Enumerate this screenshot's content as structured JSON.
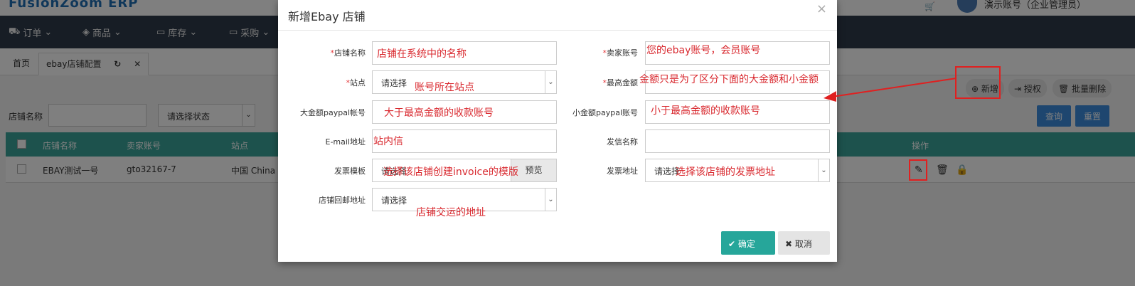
{
  "app": {
    "logo": "FusionZoom ERP",
    "cart_icon": "cart-icon",
    "user_name": "演示账号（企业管理员）",
    "nav": [
      {
        "icon": "cart-icon",
        "label": "订单"
      },
      {
        "icon": "cube-icon",
        "label": "商品"
      },
      {
        "icon": "inbox-icon",
        "label": "库存"
      },
      {
        "icon": "card-icon",
        "label": "采购"
      }
    ],
    "tabs": {
      "home": "首页",
      "active": "ebay店铺配置"
    },
    "filter": {
      "label": "店铺名称",
      "status_placeholder": "请选择状态"
    },
    "buttons": {
      "add": "新增",
      "auth": "授权",
      "batch_delete": "批量删除",
      "query": "查询",
      "reset": "重置"
    },
    "table": {
      "headers": [
        "店铺名称",
        "卖家账号",
        "站点",
        "操作"
      ],
      "rows": [
        {
          "shop_name": "EBAY测试一号",
          "seller": "gto32167-7",
          "site": "中国 China"
        }
      ]
    }
  },
  "modal": {
    "title": "新增Ebay 店铺",
    "fields": {
      "shop_name": {
        "label": "店铺名称",
        "required": "*",
        "note": "店铺在系统中的名称"
      },
      "seller_account": {
        "label": "卖家账号",
        "required": "*",
        "note": "您的ebay账号，会员账号"
      },
      "site": {
        "label": "站点",
        "required": "*",
        "placeholder": "请选择",
        "note": "账号所在站点"
      },
      "max_amount": {
        "label": "最高金额",
        "required": "*",
        "note": "金额只是为了区分下面的大金额和小金额"
      },
      "big_paypal": {
        "label": "大金额paypal帐号",
        "note": "大于最高金额的收款账号"
      },
      "small_paypal": {
        "label": "小金额paypal账号",
        "note": "小于最高金额的收款账号"
      },
      "email": {
        "label": "E-mail地址",
        "note": "站内信"
      },
      "sender_name": {
        "label": "发信名称"
      },
      "invoice_template": {
        "label": "发票模板",
        "placeholder": "请选择",
        "note": "选择该店铺创建invoice的模版",
        "preview": "预览"
      },
      "invoice_address": {
        "label": "发票地址",
        "placeholder": "请选择",
        "note": "选择该店铺的发票地址"
      },
      "return_address": {
        "label": "店铺回邮地址",
        "placeholder": "请选择",
        "note": "店铺交运的地址"
      }
    },
    "ok": "确定",
    "cancel": "取消"
  },
  "colors": {
    "annotation": "#e02020",
    "teal": "#26a69a",
    "blue": "#3c8dde",
    "nav": "#2f3a4a"
  }
}
